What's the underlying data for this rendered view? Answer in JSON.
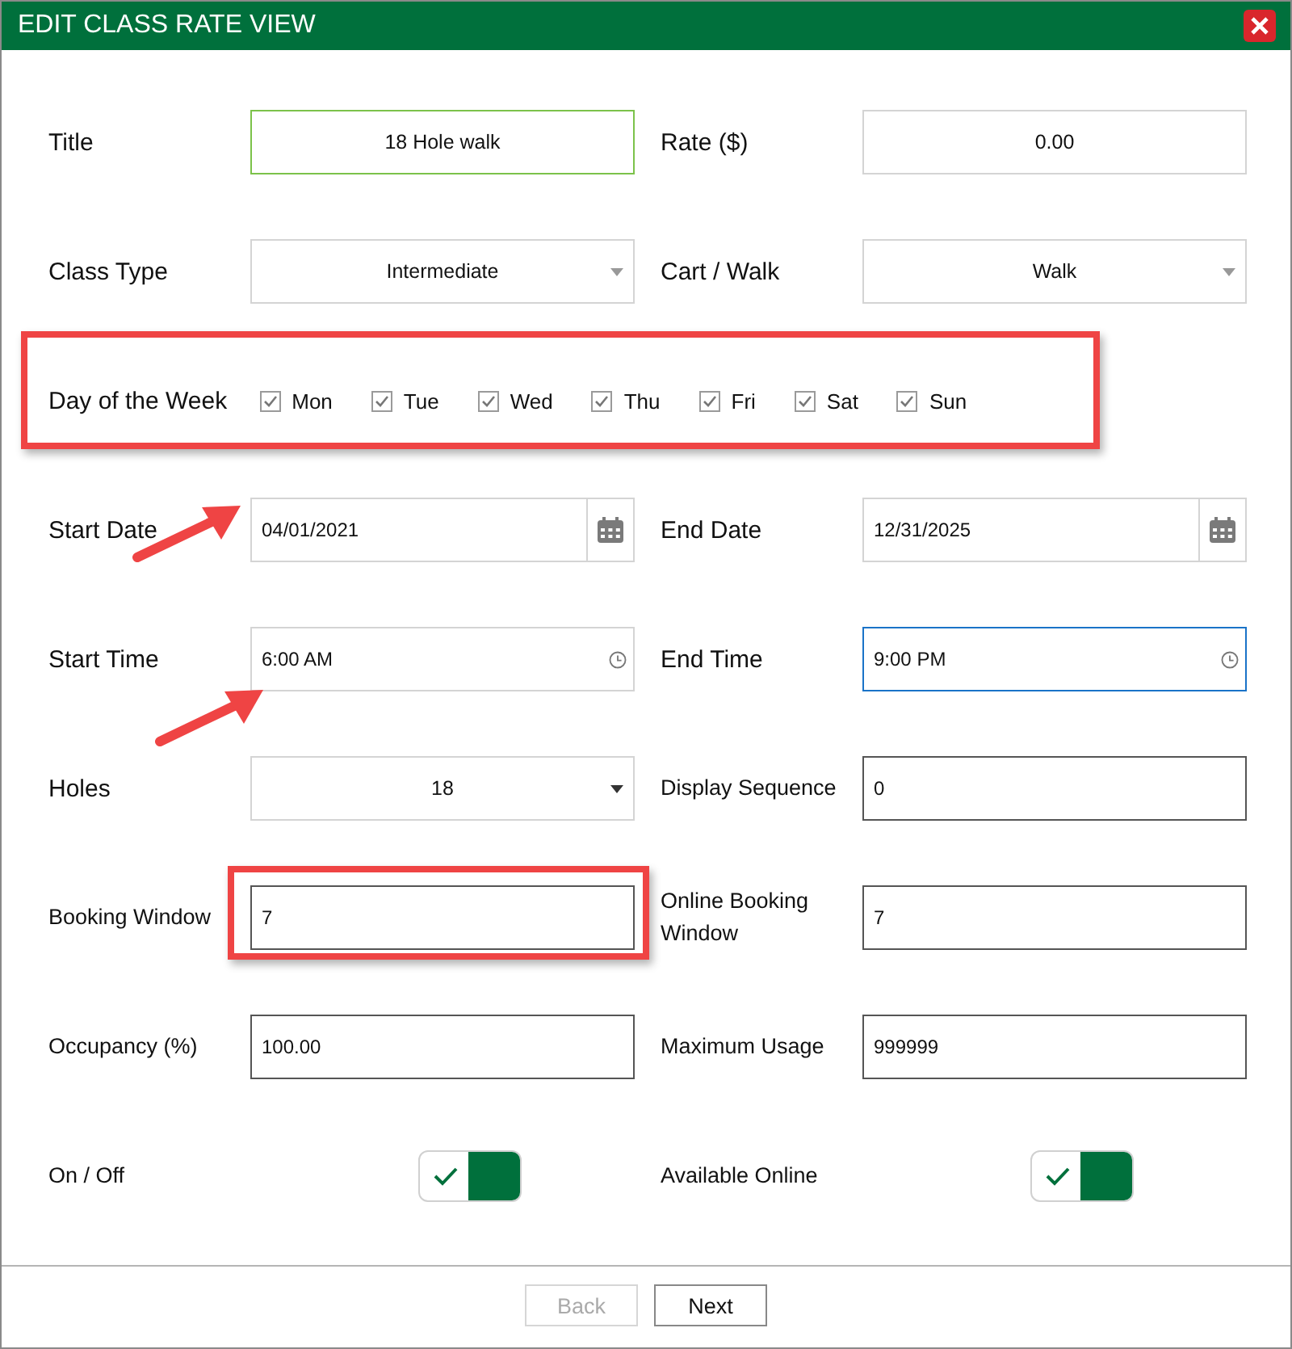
{
  "window": {
    "title": "EDIT CLASS RATE VIEW"
  },
  "rows": [
    {
      "kind": "fields",
      "fields": [
        {
          "label": "Title",
          "kind": "text",
          "value": "18 Hole walk",
          "centered": true,
          "focused": true
        },
        {
          "label": "Rate ($)",
          "kind": "text",
          "value": "0.00",
          "centered": true
        }
      ]
    },
    {
      "kind": "fields",
      "fields": [
        {
          "label": "Class Type",
          "kind": "select",
          "value": "Intermediate"
        },
        {
          "label": "Cart / Walk",
          "kind": "select",
          "value": "Walk"
        }
      ]
    },
    {
      "kind": "days",
      "label": "Day of the Week",
      "highlighted": true,
      "days": [
        {
          "label": "Mon",
          "checked": true
        },
        {
          "label": "Tue",
          "checked": true
        },
        {
          "label": "Wed",
          "checked": true
        },
        {
          "label": "Thu",
          "checked": true
        },
        {
          "label": "Fri",
          "checked": true
        },
        {
          "label": "Sat",
          "checked": true
        },
        {
          "label": "Sun",
          "checked": true
        }
      ]
    },
    {
      "kind": "fields",
      "fields": [
        {
          "label": "Start Date",
          "kind": "date",
          "value": "04/01/2021",
          "arrow": true
        },
        {
          "label": "End Date",
          "kind": "date",
          "value": "12/31/2025"
        }
      ]
    },
    {
      "kind": "fields",
      "fields": [
        {
          "label": "Start Time",
          "kind": "time",
          "value": "6:00 AM",
          "arrow": true
        },
        {
          "label": "End Time",
          "kind": "time",
          "value": "9:00 PM",
          "hovered": true
        }
      ]
    },
    {
      "kind": "fields",
      "fields": [
        {
          "label": "Holes",
          "kind": "select",
          "value": "18",
          "dark_caret": true
        },
        {
          "label": "Display Sequence",
          "kind": "number",
          "value": "0",
          "small": true
        }
      ]
    },
    {
      "kind": "fields",
      "fields": [
        {
          "label": "Booking Window",
          "kind": "number",
          "value": "7",
          "small": true,
          "highlighted": true
        },
        {
          "label": "Online Booking Window",
          "kind": "number",
          "value": "7",
          "small": true
        }
      ]
    },
    {
      "kind": "fields",
      "fields": [
        {
          "label": "Occupancy (%)",
          "kind": "number",
          "value": "100.00",
          "small": true
        },
        {
          "label": "Maximum Usage",
          "kind": "number",
          "value": "999999",
          "small": true
        }
      ]
    },
    {
      "kind": "fields",
      "fields": [
        {
          "label": "On / Off",
          "kind": "toggle",
          "on": true,
          "small": true
        },
        {
          "label": "Available Online",
          "kind": "toggle",
          "on": true,
          "small": true
        }
      ]
    }
  ],
  "buttons": [
    {
      "label": "Back",
      "disabled": true
    },
    {
      "label": "Next",
      "disabled": false
    }
  ]
}
